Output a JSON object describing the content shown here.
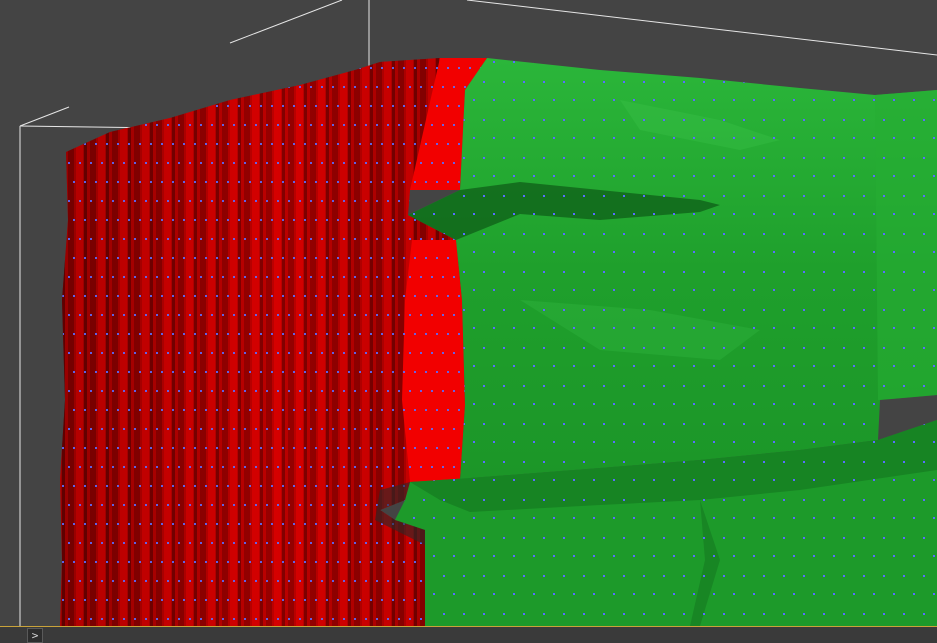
{
  "viewport": {
    "background_color": "#444444",
    "red_object_color": "#cc0000",
    "green_object_color": "#22a52e",
    "vertex_color": "#5a6cff",
    "bounding_box_color": "#e6e6e6"
  },
  "bottom_bar": {
    "accent_color": "#c9a33a",
    "expand_button_label": ">",
    "expand_button_icon": "chevron-right-icon"
  }
}
